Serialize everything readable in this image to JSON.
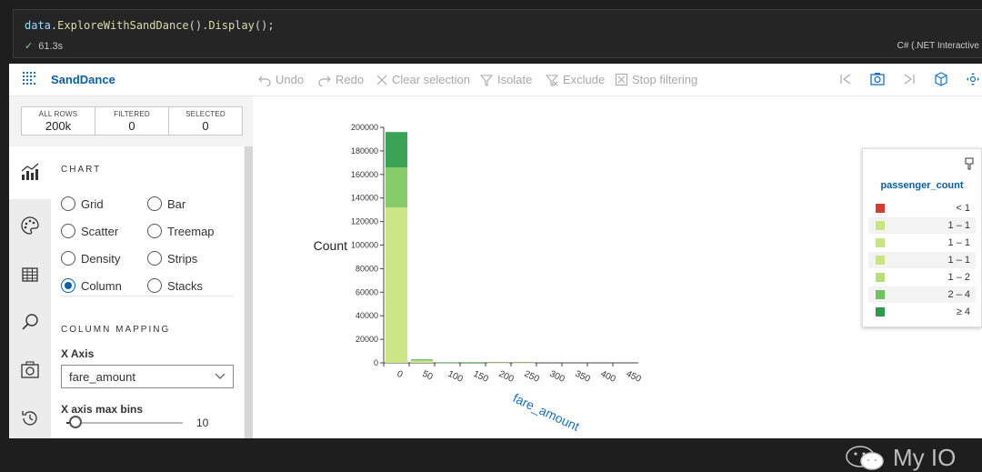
{
  "notebook": {
    "code": {
      "obj": "data",
      "dot": ".",
      "fn1": "ExploreWithSandDance",
      "mid": "().",
      "fn2": "Display",
      "end": "();"
    },
    "duration": "61.3s",
    "kernel": "C# (.NET Interactive"
  },
  "app": {
    "name": "SandDance",
    "toolbar": {
      "undo": "Undo",
      "redo": "Redo",
      "clear": "Clear selection",
      "isolate": "Isolate",
      "exclude": "Exclude",
      "stop": "Stop filtering"
    },
    "counts": [
      {
        "label": "ALL ROWS",
        "value": "200k"
      },
      {
        "label": "FILTERED",
        "value": "0"
      },
      {
        "label": "SELECTED",
        "value": "0"
      }
    ],
    "chart_section": "CHART",
    "chart_types": [
      {
        "label": "Grid",
        "selected": false
      },
      {
        "label": "Bar",
        "selected": false
      },
      {
        "label": "Scatter",
        "selected": false
      },
      {
        "label": "Treemap",
        "selected": false
      },
      {
        "label": "Density",
        "selected": false
      },
      {
        "label": "Strips",
        "selected": false
      },
      {
        "label": "Column",
        "selected": true
      },
      {
        "label": "Stacks",
        "selected": false
      }
    ],
    "mapping_section": "COLUMN MAPPING",
    "x_axis_label": "X Axis",
    "x_axis_value": "fare_amount",
    "max_bins_label": "X axis max bins",
    "max_bins_value": "10",
    "max_bins_level": 0.08
  },
  "legend": {
    "title": "passenger_count",
    "items": [
      {
        "label": "< 1",
        "color": "#d63b2f"
      },
      {
        "label": "1 – 1",
        "color": "#c7e67f"
      },
      {
        "label": "1 – 1",
        "color": "#c7e67f"
      },
      {
        "label": "1 – 1",
        "color": "#c7e67f"
      },
      {
        "label": "1 – 2",
        "color": "#b9df79"
      },
      {
        "label": "2 – 4",
        "color": "#6cc35a"
      },
      {
        "label": "≥ 4",
        "color": "#2e9a4c"
      }
    ]
  },
  "watermark": "My IO",
  "chart_data": {
    "type": "bar",
    "stacked": true,
    "ylabel": "Count",
    "xlabel": "fare_amount",
    "ylim": [
      0,
      200000
    ],
    "yticks": [
      "0",
      "20000",
      "40000",
      "60000",
      "80000",
      "100000",
      "120000",
      "140000",
      "160000",
      "180000",
      "200000"
    ],
    "xticks": [
      "0",
      "50",
      "100",
      "150",
      "200",
      "250",
      "300",
      "350",
      "400",
      "450"
    ],
    "categories": [
      "0–50",
      "50–100",
      "100–150",
      "150–200",
      "200–250",
      "250–300",
      "300–350",
      "350–400",
      "400–450",
      "450–500"
    ],
    "series": [
      {
        "name": "1 – 1",
        "color": "#cde685",
        "values": [
          132000,
          1800,
          60,
          20,
          10,
          5,
          0,
          0,
          0,
          0
        ]
      },
      {
        "name": "2 – 4",
        "color": "#86cc6a",
        "values": [
          34000,
          700,
          20,
          5,
          0,
          0,
          0,
          0,
          0,
          0
        ]
      },
      {
        "name": "≥ 4",
        "color": "#3aa356",
        "values": [
          30000,
          500,
          15,
          5,
          0,
          0,
          0,
          0,
          0,
          0
        ]
      }
    ]
  }
}
